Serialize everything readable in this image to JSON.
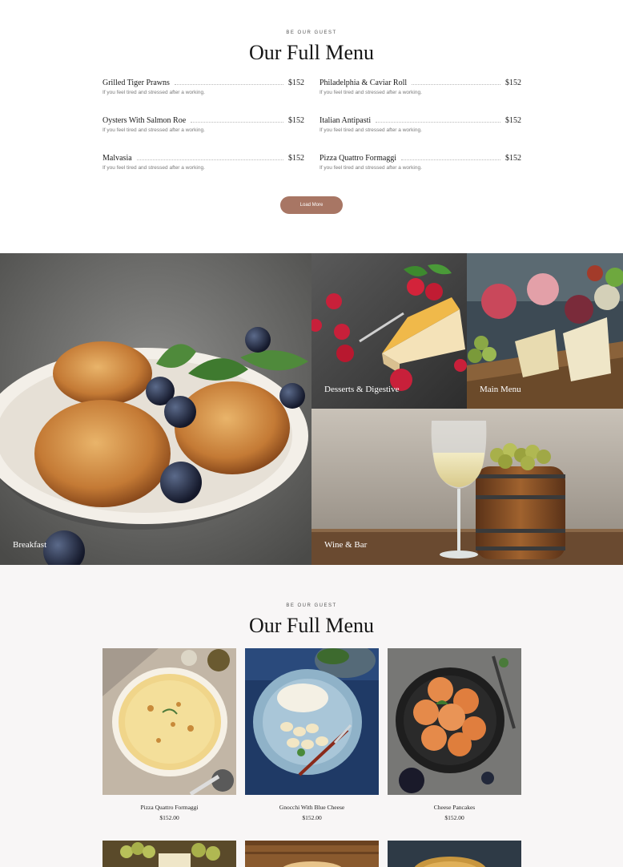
{
  "section1": {
    "eyebrow": "BE OUR GUEST",
    "title": "Our Full Menu",
    "items": [
      {
        "name": "Grilled Tiger Prawns",
        "price": "$152",
        "desc": "If you feel tired and stressed after a working."
      },
      {
        "name": "Philadelphia & Caviar Roll",
        "price": "$152",
        "desc": "If you feel tired and stressed after a working."
      },
      {
        "name": "Oysters With Salmon Roe",
        "price": "$152",
        "desc": "If you feel tired and stressed after a working."
      },
      {
        "name": "Italian Antipasti",
        "price": "$152",
        "desc": "If you feel tired and stressed after a working."
      },
      {
        "name": "Malvasia",
        "price": "$152",
        "desc": "If you feel tired and stressed after a working."
      },
      {
        "name": "Pizza Quattro Formaggi",
        "price": "$152",
        "desc": "If you feel tired and stressed after a working."
      }
    ],
    "load_more_label": "Load More",
    "accent_color": "#a87664"
  },
  "gallery": {
    "breakfast": "Breakfast",
    "desserts": "Desserts & Digestive",
    "main_menu": "Main Menu",
    "wine_bar": "Wine & Bar"
  },
  "section3": {
    "eyebrow": "BE OUR GUEST",
    "title": "Our Full Menu",
    "cards": [
      {
        "name": "Pizza Quattro Formaggi",
        "price": "$152.00"
      },
      {
        "name": "Gnocchi With Blue Cheese",
        "price": "$152.00"
      },
      {
        "name": "Cheese Pancakes",
        "price": "$152.00"
      }
    ]
  }
}
